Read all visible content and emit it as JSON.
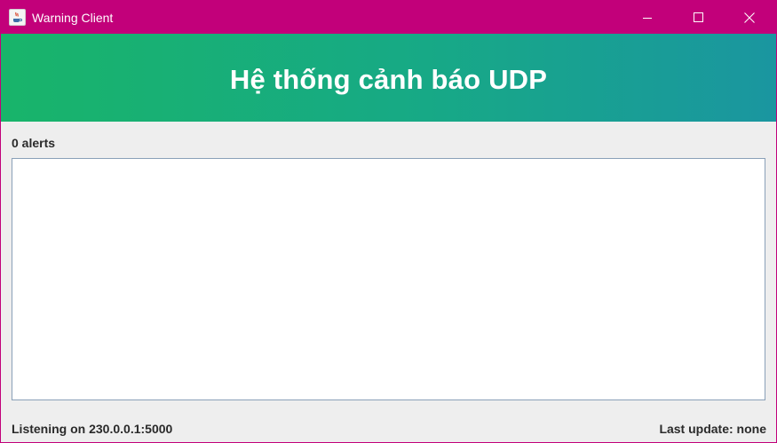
{
  "window": {
    "title": "Warning Client",
    "controls": {
      "minimize_icon": "minimize-icon",
      "maximize_icon": "maximize-icon",
      "close_icon": "close-icon"
    }
  },
  "header": {
    "title": "Hệ thống cảnh báo UDP"
  },
  "alerts": {
    "count_label": "0 alerts",
    "items": []
  },
  "status": {
    "listening": "Listening on 230.0.0.1:5000",
    "last_update": "Last update: none"
  },
  "colors": {
    "titlebar": "#c2007a",
    "banner_start": "#18b46a",
    "banner_end": "#1a96a0",
    "background": "#eeeeee"
  }
}
